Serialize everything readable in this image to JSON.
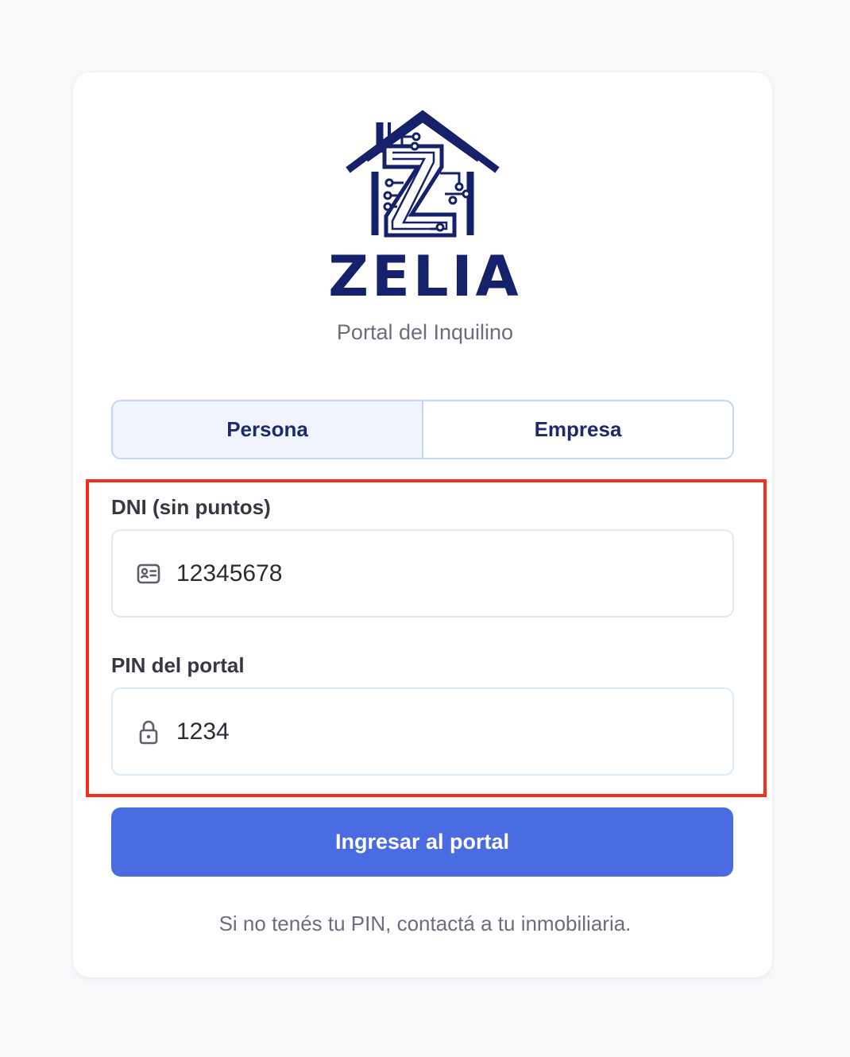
{
  "brand": {
    "name": "ZELIA",
    "subtitle": "Portal del Inquilino",
    "color": "#16216b"
  },
  "login_type": {
    "options": [
      "Persona",
      "Empresa"
    ],
    "selected": "Persona"
  },
  "form": {
    "dni": {
      "label": "DNI (sin puntos)",
      "value": "12345678",
      "icon": "id-card-icon"
    },
    "pin": {
      "label": "PIN del portal",
      "value": "1234",
      "icon": "lock-icon"
    }
  },
  "submit": {
    "label": "Ingresar al portal",
    "color": "#4a6ce2"
  },
  "help_text": "Si no tenés tu PIN, contactá a tu inmobiliaria.",
  "highlight_color": "#f62f1c"
}
